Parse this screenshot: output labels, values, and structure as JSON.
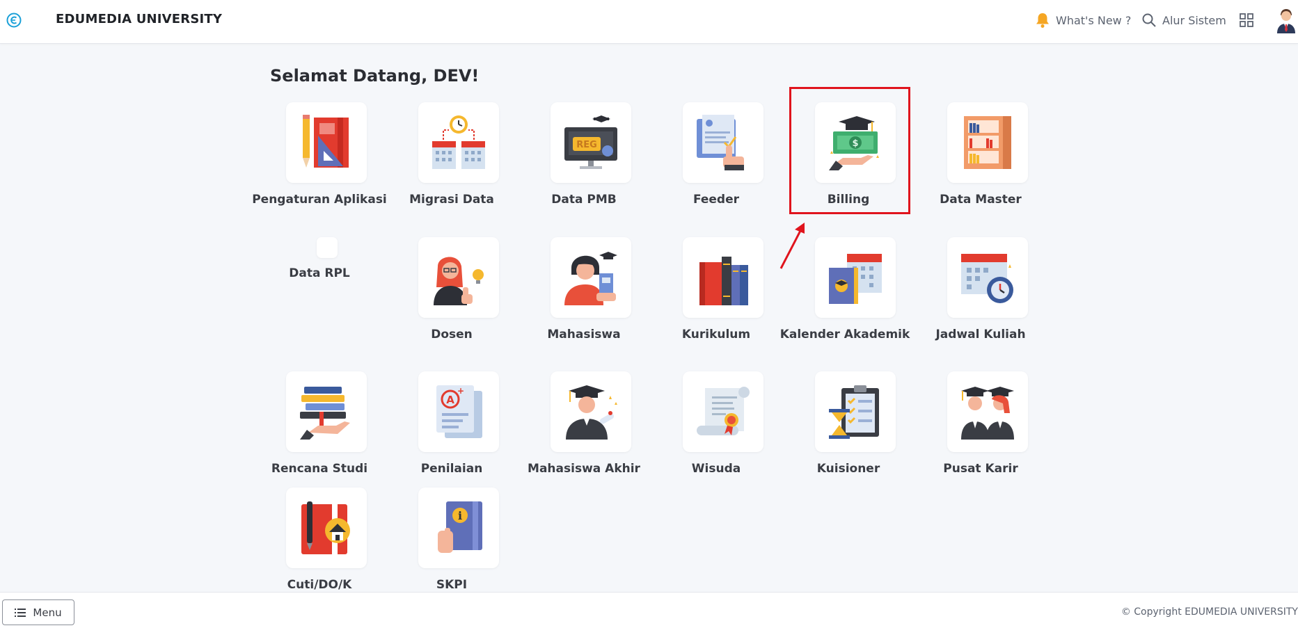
{
  "header": {
    "brand": "EDUMEDIA UNIVERSITY",
    "whats_new": "What's New ?",
    "alur_sistem": "Alur Sistem",
    "accent_color": "#f5a623"
  },
  "main": {
    "greeting": "Selamat Datang, DEV!",
    "apps": [
      {
        "label": "Pengaturan Aplikasi",
        "icon": "ruler-pencil-book-icon"
      },
      {
        "label": "Migrasi Data",
        "icon": "calendar-clock-icon"
      },
      {
        "label": "Data PMB",
        "icon": "monitor-reg-icon"
      },
      {
        "label": "Feeder",
        "icon": "document-touch-icon"
      },
      {
        "label": "Billing",
        "icon": "money-graduation-icon"
      },
      {
        "label": "Data Master",
        "icon": "bookshelf-icon"
      },
      {
        "label": "Data RPL",
        "icon": "blank-icon"
      },
      {
        "label": "Dosen",
        "icon": "lecturer-idea-icon"
      },
      {
        "label": "Mahasiswa",
        "icon": "student-book-icon"
      },
      {
        "label": "Kurikulum",
        "icon": "books-stack-icon"
      },
      {
        "label": "Kalender Akademik",
        "icon": "academic-calendar-icon"
      },
      {
        "label": "Jadwal Kuliah",
        "icon": "schedule-clock-icon"
      },
      {
        "label": "Rencana Studi",
        "icon": "books-hand-icon"
      },
      {
        "label": "Penilaian",
        "icon": "grade-paper-icon"
      },
      {
        "label": "Mahasiswa Akhir",
        "icon": "graduate-diploma-icon"
      },
      {
        "label": "Wisuda",
        "icon": "certificate-scroll-icon"
      },
      {
        "label": "Kuisioner",
        "icon": "clipboard-hourglass-icon"
      },
      {
        "label": "Pusat Karir",
        "icon": "graduates-pair-icon"
      },
      {
        "label": "Cuti/DO/K",
        "icon": "notebook-home-icon"
      },
      {
        "label": "SKPI",
        "icon": "info-book-icon"
      }
    ],
    "highlight_color": "#e0141d"
  },
  "footer": {
    "menu_label": "Menu",
    "copyright": "© Copyright EDUMEDIA UNIVERSITY"
  }
}
